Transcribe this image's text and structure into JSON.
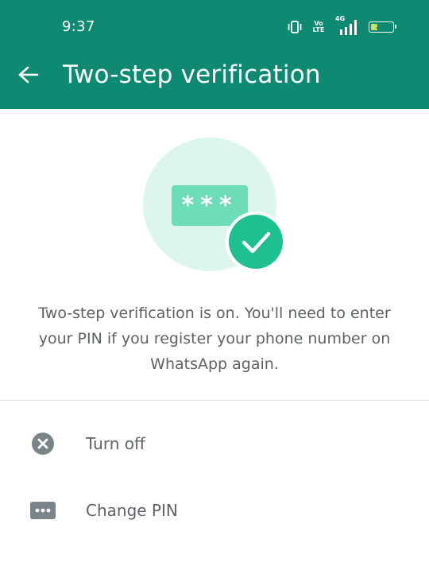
{
  "status_bar": {
    "time": "9:37",
    "volte_label_top": "Vo",
    "volte_label_bottom": "LTE",
    "network_label": "4G",
    "battery_level": "29"
  },
  "header": {
    "title": "Two-step verification",
    "back_icon": "arrow-left-icon"
  },
  "illustration": {
    "password_mask": "***",
    "check_icon": "check-circle-icon"
  },
  "description": "Two-step verification is on. You'll need to enter your PIN if you register your phone number on WhatsApp again.",
  "actions": [
    {
      "label": "Turn off",
      "icon": "close-circle-icon"
    },
    {
      "label": "Change PIN",
      "icon": "password-dots-icon"
    }
  ],
  "colors": {
    "header": "#0f8a72",
    "accent": "#1fc08f",
    "illustration_bg": "#dcf6ee",
    "text": "#5b6366",
    "icon_gray": "#7a8489"
  }
}
